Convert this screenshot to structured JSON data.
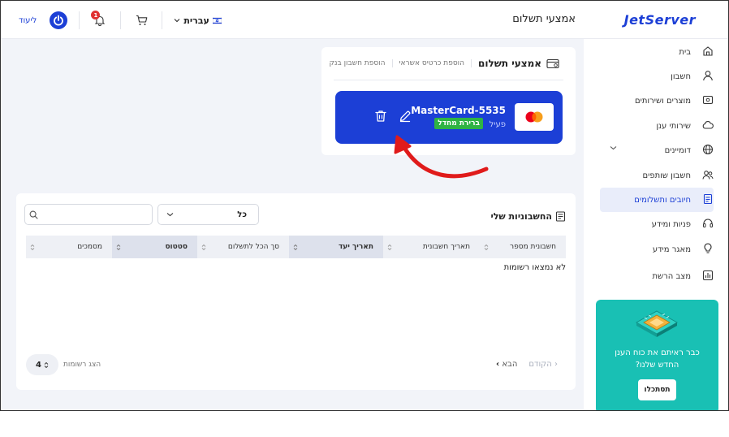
{
  "header": {
    "logo": "JetServer",
    "page_title": "אמצעי תשלום",
    "language": "עברית",
    "notification_count": "1",
    "logout_label": "ליעוד"
  },
  "sidebar": {
    "items": [
      {
        "label": "בית",
        "icon": "home-icon"
      },
      {
        "label": "חשבון",
        "icon": "user-icon"
      },
      {
        "label": "מוצרים ושירותים",
        "icon": "box-icon"
      },
      {
        "label": "שירותי ענן",
        "icon": "cloud-icon"
      },
      {
        "label": "דומיינים",
        "icon": "globe-icon"
      },
      {
        "label": "חשבון שותפים",
        "icon": "users-icon"
      },
      {
        "label": "חיובים ותשלומים",
        "icon": "invoice-icon",
        "active": true
      },
      {
        "label": "פניות ומידע",
        "icon": "headset-icon"
      },
      {
        "label": "מאגר מידע",
        "icon": "lightbulb-icon"
      },
      {
        "label": "מצב הרשת",
        "icon": "chart-icon"
      }
    ],
    "promo": {
      "text_line1": "כבר ראיתם את כוח הענן",
      "text_line2": "החדש שלנו?",
      "button": "תסתכלו"
    }
  },
  "payment_methods": {
    "title": "אמצעי תשלום",
    "tabs": [
      "הוספת כרטיס אשראי",
      "הוספת חשבון בנק"
    ],
    "card": {
      "name": "MasterCard-5535",
      "status": "פעיל",
      "default_label": "ברירת מחדל"
    }
  },
  "invoices": {
    "title": "החשבוניות שלי",
    "filter_value": "כל",
    "search_placeholder": "",
    "columns": [
      "חשבונית מספר",
      "תאריך חשבונית",
      "תאריך יעד",
      "סך הכל לתשלום",
      "סטטוס",
      "מסמכים"
    ],
    "empty_text": "לא נמצאו רשומות",
    "pager": {
      "prev": "הקודם",
      "next": "הבא"
    },
    "rows_per_page_label": "הצג רשומות",
    "rows_per_page": "4"
  },
  "colors": {
    "brand": "#1c3fd6",
    "promo": "#19c0b4",
    "default_badge": "#2fb344",
    "arrow": "#e01b1b"
  }
}
